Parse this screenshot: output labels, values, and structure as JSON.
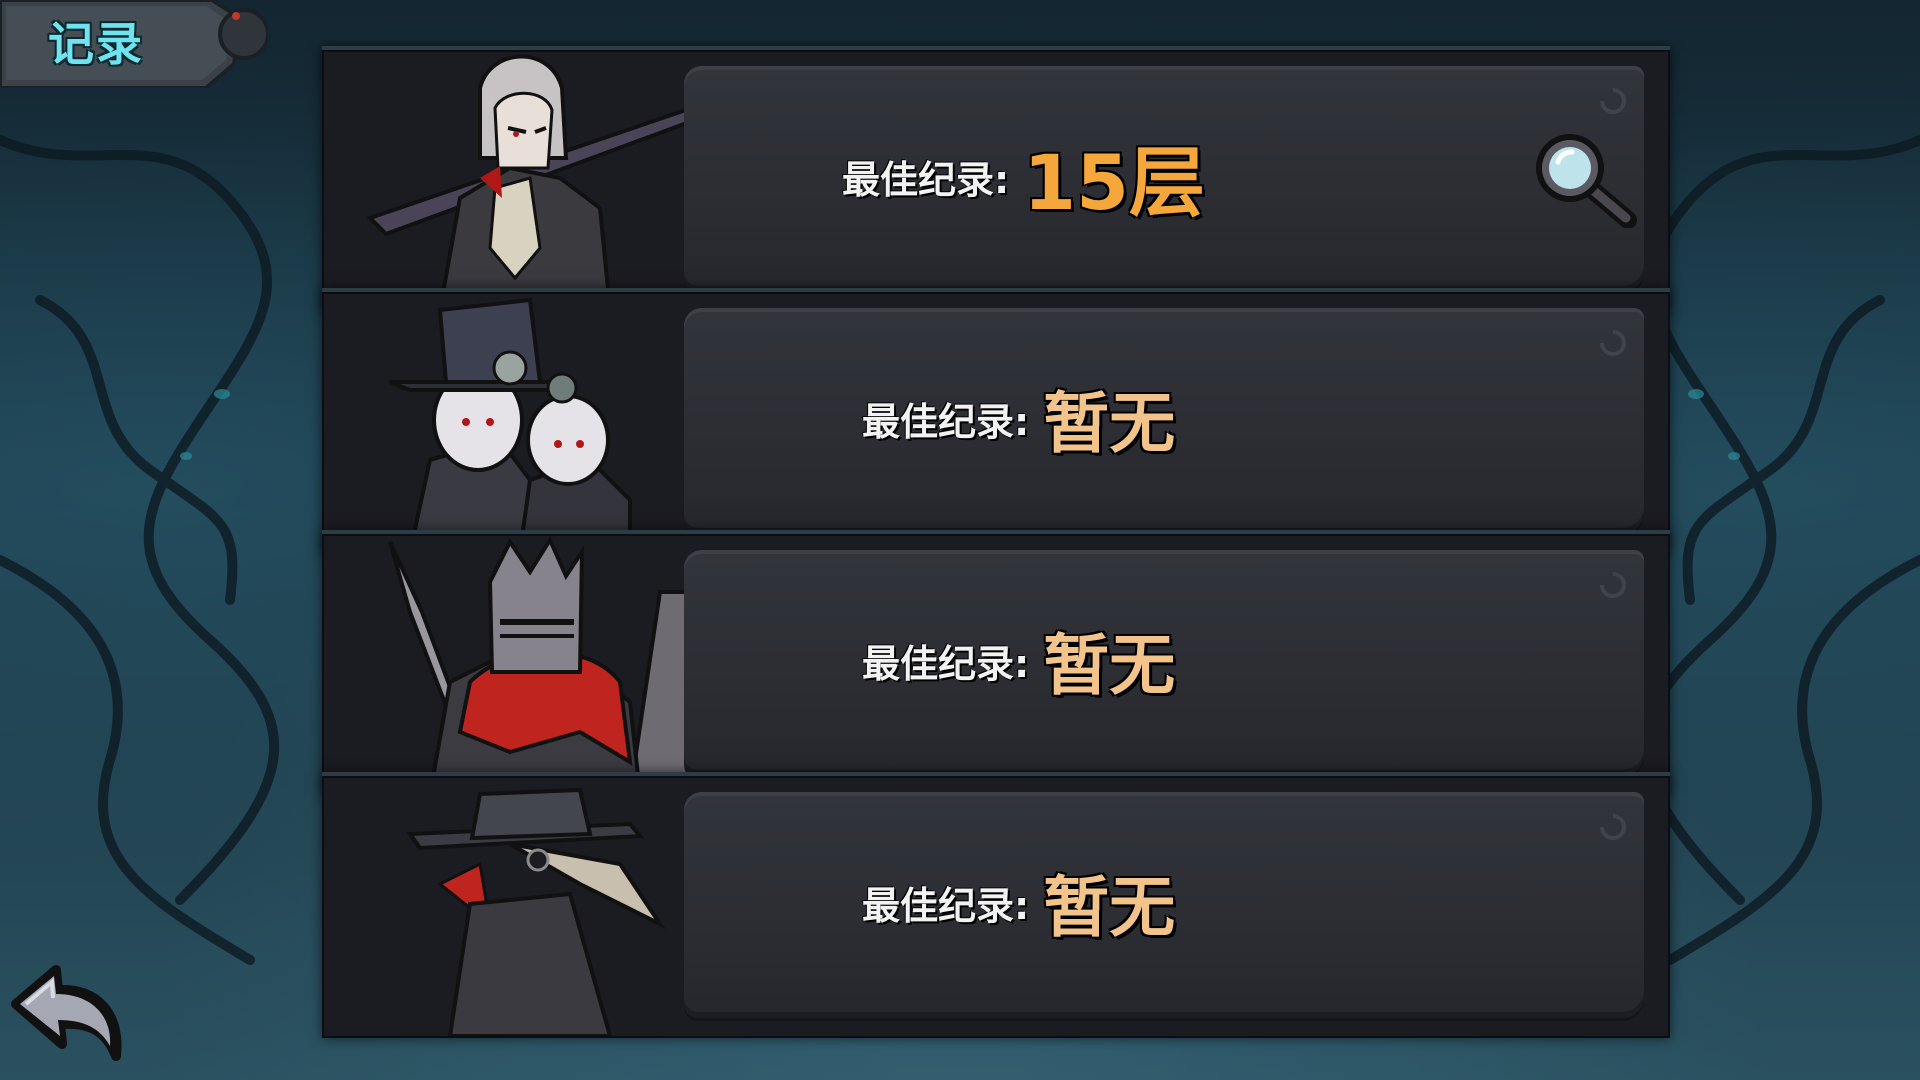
{
  "title": "记录",
  "records": [
    {
      "label": "最佳纪录:",
      "value": "15层",
      "is_best": true,
      "has_detail": true,
      "character": "swordsman"
    },
    {
      "label": "最佳纪录:",
      "value": "暂无",
      "is_best": false,
      "has_detail": false,
      "character": "twins"
    },
    {
      "label": "最佳纪录:",
      "value": "暂无",
      "is_best": false,
      "has_detail": false,
      "character": "knight"
    },
    {
      "label": "最佳纪录:",
      "value": "暂无",
      "is_best": false,
      "has_detail": false,
      "character": "plague-doctor"
    }
  ],
  "icons": {
    "detail": "magnifier-icon",
    "back": "back-arrow-icon"
  },
  "colors": {
    "title": "#6fe3ef",
    "best_value": "#f6a73c",
    "value": "#f2c48c",
    "label": "#f2f2f2"
  }
}
